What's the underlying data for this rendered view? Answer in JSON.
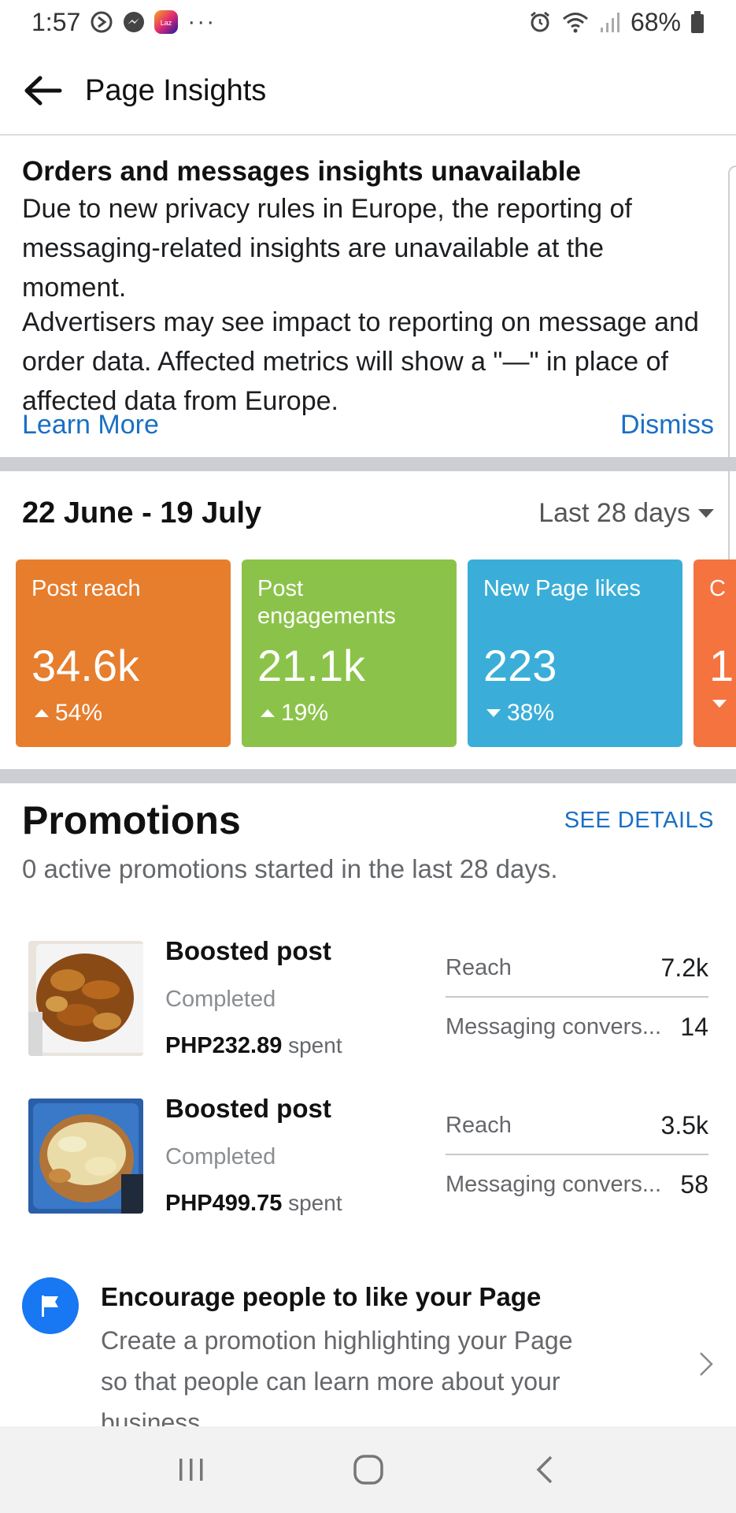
{
  "status_bar": {
    "time": "1:57",
    "more": "···",
    "battery": "68%",
    "lazada_label": "Laz"
  },
  "header": {
    "title": "Page Insights"
  },
  "notice": {
    "title": "Orders and messages insights unavailable",
    "paragraph1": "Due to new privacy rules in Europe, the reporting of messaging-related insights are unavailable at the moment.",
    "paragraph2": "Advertisers may see impact to reporting on message and order data. Affected metrics will show a \"—\" in place of affected data from Europe.",
    "learn_more": "Learn More",
    "dismiss": "Dismiss"
  },
  "date_range": {
    "range": "22 June - 19 July",
    "selector": "Last 28 days"
  },
  "metrics": [
    {
      "label": "Post reach",
      "value": "34.6k",
      "change": "54%",
      "direction": "up",
      "color": "#e67e2e"
    },
    {
      "label": "Post engagements",
      "value": "21.1k",
      "change": "19%",
      "direction": "up",
      "color": "#8bc34a"
    },
    {
      "label": "New Page likes",
      "value": "223",
      "change": "38%",
      "direction": "down",
      "color": "#3aaed8"
    },
    {
      "label": "C",
      "value": "1",
      "change": "",
      "direction": "down",
      "color": "#f4733f"
    }
  ],
  "promotions": {
    "title": "Promotions",
    "see_details": "SEE DETAILS",
    "subtitle": "0 active promotions started in the last 28 days.",
    "spent_suffix": "spent",
    "items": [
      {
        "title": "Boosted post",
        "status": "Completed",
        "amount": "PHP232.89",
        "stat1_label": "Reach",
        "stat1_value": "7.2k",
        "stat2_label": "Messaging convers...",
        "stat2_value": "14"
      },
      {
        "title": "Boosted post",
        "status": "Completed",
        "amount": "PHP499.75",
        "stat1_label": "Reach",
        "stat1_value": "3.5k",
        "stat2_label": "Messaging convers...",
        "stat2_value": "58"
      }
    ]
  },
  "encourage": {
    "title": "Encourage people to like your Page",
    "body": "Create a promotion highlighting your Page so that people can learn more about your business."
  },
  "colors": {
    "link": "#1a6fc4",
    "facebook_blue": "#1877f2",
    "divider": "#ccced3"
  }
}
